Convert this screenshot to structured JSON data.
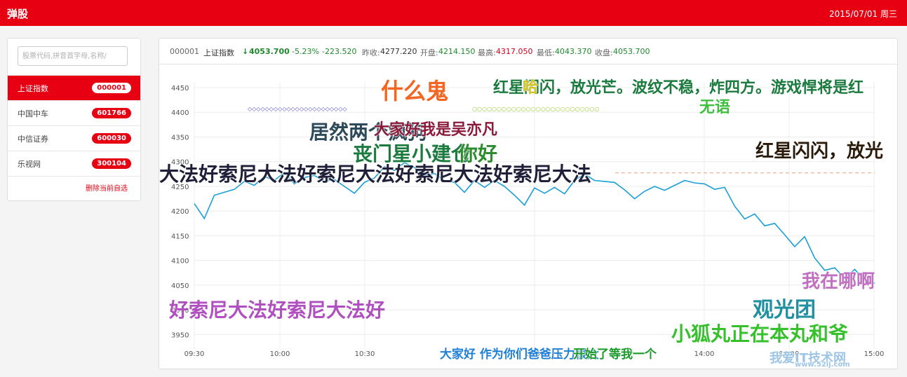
{
  "app": {
    "title": "弹股",
    "date": "2015/07/01 周三"
  },
  "sidebar": {
    "search_placeholder": "股票代码,拼音首字母,名称/",
    "stocks": [
      {
        "name": "上证指数",
        "code": "000001",
        "active": true
      },
      {
        "name": "中国中车",
        "code": "601766",
        "active": false
      },
      {
        "name": "中信证券",
        "code": "600030",
        "active": false
      },
      {
        "name": "乐视网",
        "code": "300104",
        "active": false
      }
    ],
    "delete_label": "删除当前自选"
  },
  "quote": {
    "code": "000001",
    "name": "上证指数",
    "arrow": "↓",
    "price": "4053.700",
    "change_pct": "-5.23%",
    "change": "-223.520",
    "prev_close_label": "昨收:",
    "prev_close": "4277.220",
    "open_label": "开盘:",
    "open": "4214.150",
    "high_label": "最高:",
    "high": "4317.050",
    "low_label": "最低:",
    "low": "4043.370",
    "close_label": "收盘:",
    "close": "4053.700"
  },
  "colors": {
    "brand": "#e60012",
    "line": "#1a9fd6",
    "up": "#d0021b",
    "down": "#1f8a2c"
  },
  "chart_data": {
    "type": "line",
    "ylim": [
      3925,
      4450
    ],
    "yticks": [
      "4450",
      "4400",
      "4350",
      "4300",
      "4250",
      "4200",
      "4150",
      "4100",
      "4050",
      "4000",
      "3950"
    ],
    "xticks": [
      "09:30",
      "10:00",
      "10:30",
      "11:30",
      "14:00",
      "14:30",
      "15:00"
    ],
    "prev_close_reference": 4277.22,
    "series": [
      {
        "values": [
          4215,
          4185,
          4232,
          4238,
          4244,
          4260,
          4252,
          4270,
          4262,
          4278,
          4255,
          4268,
          4272,
          4260,
          4264,
          4250,
          4236,
          4258,
          4267,
          4290,
          4282,
          4298,
          4288,
          4272,
          4276,
          4262,
          4258,
          4238,
          4262,
          4248,
          4262,
          4250,
          4232,
          4212,
          4247,
          4236,
          4248,
          4235,
          4262,
          4275,
          4262,
          4260,
          4258,
          4243,
          4225,
          4240,
          4250,
          4242,
          4252,
          4262,
          4257,
          4255,
          4244,
          4248,
          4210,
          4184,
          4194,
          4170,
          4175,
          4152,
          4128,
          4148,
          4105,
          4080,
          4085,
          4064,
          4082,
          4060,
          4053.7
        ]
      }
    ]
  },
  "danmaku": [
    {
      "text": "什么鬼",
      "color": "#f26522"
    },
    {
      "text": "红星闪闪，放光芒。波纹不稳，炸四方。游戏悍将是红",
      "color": "#1b7a3e"
    },
    {
      "text": "哈",
      "color": "#d4c21e"
    },
    {
      "text": "无语",
      "color": "#3fbf3f"
    },
    {
      "text": "○○○○○○○○○○○○○○○○○○○○○○○○○○",
      "color": "#9acd32"
    },
    {
      "text": "◇◇◇◇◇◇◇◇◇◇◇◇◇◇◇◇◇◇◇◇◇◇◇",
      "color": "#4a4ac0"
    },
    {
      "text": "居然两个疯狗",
      "color": "#2d4a5a"
    },
    {
      "text": "大家好我是吴亦凡",
      "color": "#8b1a3a"
    },
    {
      "text": "丧门星小建仓",
      "color": "#1b7a3e"
    },
    {
      "text": "你好",
      "color": "#2e8b2e"
    },
    {
      "text": "红星闪闪，放光",
      "color": "#2a1a0a"
    },
    {
      "text": "大法好索尼大法好索尼大法好索尼大法好索尼大法",
      "color": "#1f1f3a"
    },
    {
      "text": "我在哪啊",
      "color": "#c070c0"
    },
    {
      "text": "好索尼大法好索尼大法好",
      "color": "#b050c0"
    },
    {
      "text": "观光团",
      "color": "#2090a0"
    },
    {
      "text": "小狐丸正在本丸和爷",
      "color": "#36c02c"
    },
    {
      "text": "大家好 作为你们爸爸压力很大",
      "color": "#1e7fd6"
    },
    {
      "text": "开始了等我一个",
      "color": "#1a9a2a"
    },
    {
      "text": "我爱IT技术网",
      "color": "#9ec5e6"
    },
    {
      "text": "www.52ij.com",
      "color": "#9ec5e6"
    }
  ]
}
